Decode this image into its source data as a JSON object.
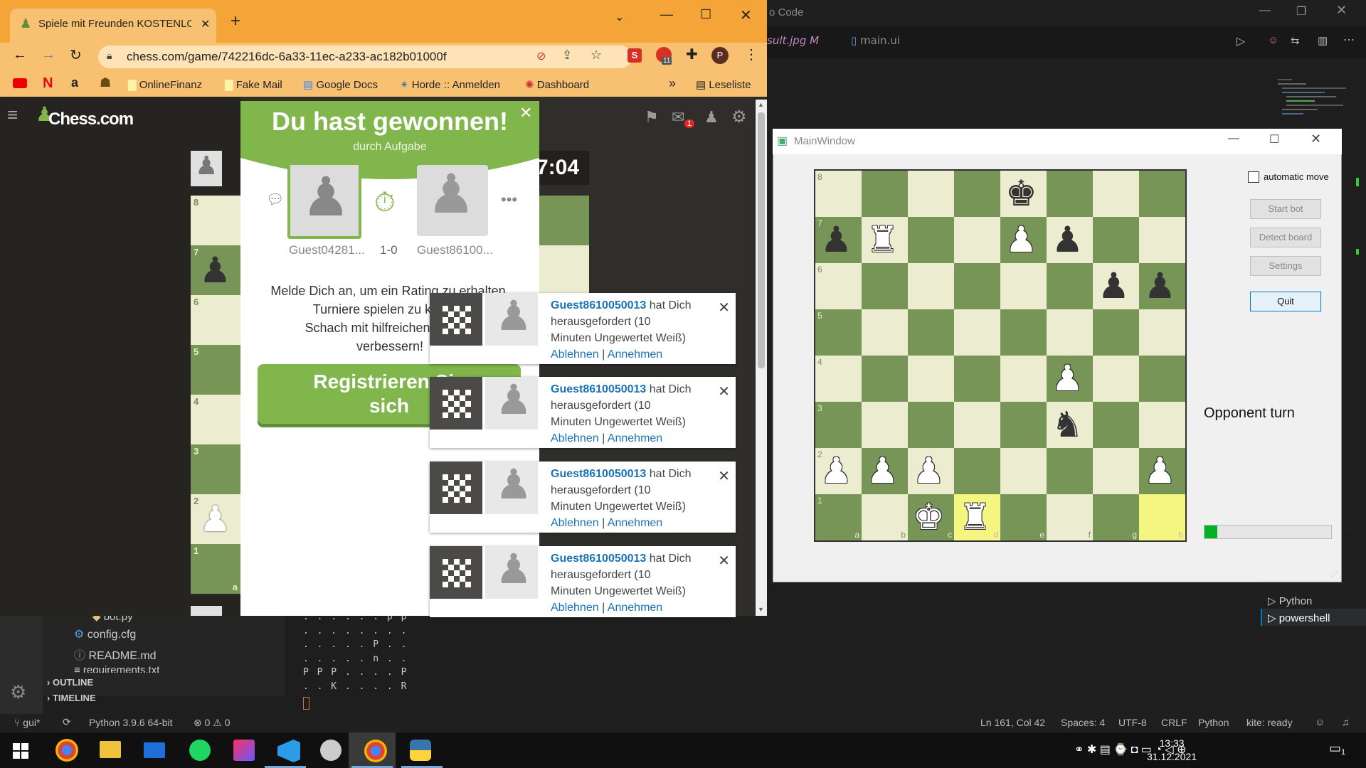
{
  "vscode": {
    "title_fragment": "o Code",
    "tabs": [
      "sult.jpg M",
      "main.ui"
    ],
    "explorer_items": [
      "bot.py",
      "config.cfg",
      "README.md",
      "requirements.txt"
    ],
    "sections": [
      "OUTLINE",
      "TIMELINE"
    ],
    "terminal_lines": [
      ". . . . . . p p",
      ". . . . . . . .",
      ". . . . . P . .",
      ". . . . . n . .",
      "P P P . . . . P",
      ". . K . . . . R"
    ],
    "terminal_tabs": [
      "Python",
      "powershell"
    ],
    "status": {
      "branch": "gui*",
      "python": "Python 3.9.6 64-bit",
      "problems": "⊗ 0 ⚠ 0",
      "position": "Ln 161, Col 42",
      "spaces": "Spaces: 4",
      "encoding": "UTF-8",
      "eol": "CRLF",
      "language": "Python",
      "kite": "kite: ready"
    }
  },
  "chrome": {
    "tab_title": "Spiele mit Freunden KOSTENLOS",
    "url": "chess.com/game/742216dc-6a33-11ec-a233-ac182b01000f",
    "bookmarks": [
      "OnlineFinanz",
      "Fake Mail",
      "Google Docs",
      "Horde :: Anmelden",
      "Dashboard"
    ],
    "reading_list": "Leseliste",
    "overflow": "»"
  },
  "chesscom": {
    "logo": "Chess.com",
    "clock": "7:04",
    "mail_badge": "1",
    "rank_labels": [
      "8",
      "7",
      "6",
      "5",
      "4",
      "3",
      "2",
      "1"
    ],
    "file_label": "a"
  },
  "modal": {
    "title": "Du hast gewonnen!",
    "subtitle": "durch Aufgabe",
    "player1": "Guest04281...",
    "player2": "Guest86100...",
    "score": "1-0",
    "body_lines": [
      "Melde Dich an, um ein Rating zu erhalten,",
      "Turniere spielen zu können",
      "Schach mit hilfreichen Compu",
      "verbessern!"
    ],
    "register_label_1": "Registrieren Sie",
    "register_label_2": "sich"
  },
  "notifications": [
    {
      "user": "Guest8610050013",
      "text1": " hat Dich",
      "text2": "herausgefordert (10",
      "text3": "Minuten Ungewertet Weiß)",
      "decline": "Ablehnen",
      "accept": "Annehmen"
    },
    {
      "user": "Guest8610050013",
      "text1": " hat Dich",
      "text2": "herausgefordert (10",
      "text3": "Minuten Ungewertet Weiß)",
      "decline": "Ablehnen",
      "accept": "Annehmen"
    },
    {
      "user": "Guest8610050013",
      "text1": " hat Dich",
      "text2": "herausgefordert (10",
      "text3": "Minuten Ungewertet Weiß)",
      "decline": "Ablehnen",
      "accept": "Annehmen"
    },
    {
      "user": "Guest8610050013",
      "text1": " hat Dich",
      "text2": "herausgefordert (10",
      "text3": "Minuten Ungewertet Weiß)",
      "decline": "Ablehnen",
      "accept": "Annehmen"
    }
  ],
  "mainwindow": {
    "title": "MainWindow",
    "automatic_move": "automatic move",
    "buttons": {
      "start": "Start bot",
      "detect": "Detect board",
      "settings": "Settings",
      "quit": "Quit"
    },
    "status": "Opponent turn",
    "progress": 0.1,
    "ranks": [
      "8",
      "7",
      "6",
      "5",
      "4",
      "3",
      "2",
      "1"
    ],
    "files": [
      "a",
      "b",
      "c",
      "d",
      "e",
      "f",
      "g",
      "h"
    ],
    "board": [
      ". . . . k . . .",
      "p R . . P p . .",
      ". . . . . . p p",
      ". . . . . . . .",
      ". . . . . P . .",
      ". . . . . n . .",
      "P P P . . . . P",
      ". . K R . . . ."
    ],
    "highlight_squares": [
      "d1",
      "h1"
    ]
  },
  "taskbar": {
    "time": "13:33",
    "date": "31.12.2021",
    "notif_count": "1"
  },
  "colors": {
    "board_light": "#ebecd0",
    "board_dark": "#779556",
    "highlight": "#f5f682",
    "chesscom_green": "#81b64c",
    "link_blue": "#1a73b8"
  }
}
